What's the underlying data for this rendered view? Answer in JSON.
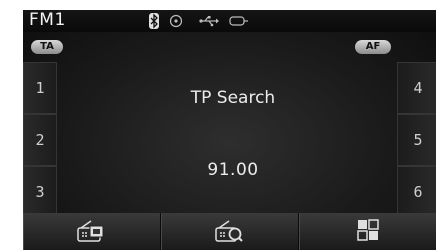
{
  "header": {
    "title": "FM1"
  },
  "status_icons": [
    "bluetooth-icon",
    "disc-icon",
    "usb-icon",
    "aux-icon"
  ],
  "buttons": {
    "ta": "TA",
    "af": "AF"
  },
  "presets_left": [
    "1",
    "2",
    "3"
  ],
  "presets_right": [
    "4",
    "5",
    "6"
  ],
  "main": {
    "status": "TP Search",
    "frequency": "91.00"
  },
  "bottom_bar": [
    "radio-list-icon",
    "radio-scan-icon",
    "menu-grid-icon"
  ]
}
